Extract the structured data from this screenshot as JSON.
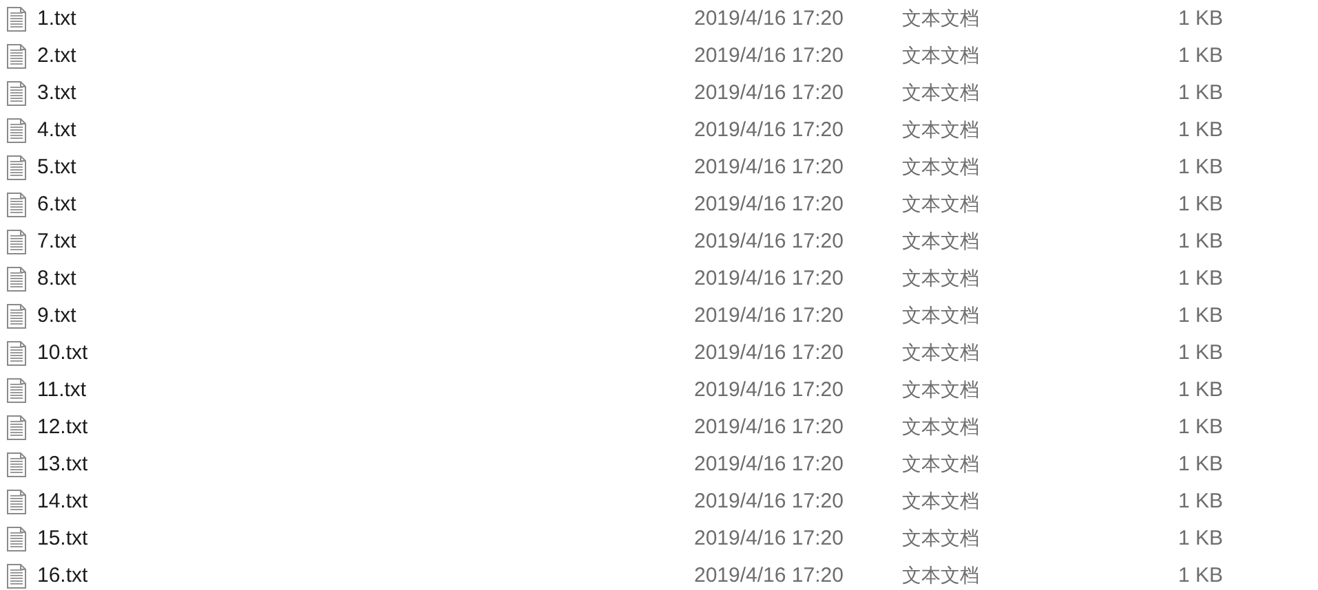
{
  "files": [
    {
      "name": "1.txt",
      "modified": "2019/4/16 17:20",
      "type": "文本文档",
      "size": "1 KB"
    },
    {
      "name": "2.txt",
      "modified": "2019/4/16 17:20",
      "type": "文本文档",
      "size": "1 KB"
    },
    {
      "name": "3.txt",
      "modified": "2019/4/16 17:20",
      "type": "文本文档",
      "size": "1 KB"
    },
    {
      "name": "4.txt",
      "modified": "2019/4/16 17:20",
      "type": "文本文档",
      "size": "1 KB"
    },
    {
      "name": "5.txt",
      "modified": "2019/4/16 17:20",
      "type": "文本文档",
      "size": "1 KB"
    },
    {
      "name": "6.txt",
      "modified": "2019/4/16 17:20",
      "type": "文本文档",
      "size": "1 KB"
    },
    {
      "name": "7.txt",
      "modified": "2019/4/16 17:20",
      "type": "文本文档",
      "size": "1 KB"
    },
    {
      "name": "8.txt",
      "modified": "2019/4/16 17:20",
      "type": "文本文档",
      "size": "1 KB"
    },
    {
      "name": "9.txt",
      "modified": "2019/4/16 17:20",
      "type": "文本文档",
      "size": "1 KB"
    },
    {
      "name": "10.txt",
      "modified": "2019/4/16 17:20",
      "type": "文本文档",
      "size": "1 KB"
    },
    {
      "name": "11.txt",
      "modified": "2019/4/16 17:20",
      "type": "文本文档",
      "size": "1 KB"
    },
    {
      "name": "12.txt",
      "modified": "2019/4/16 17:20",
      "type": "文本文档",
      "size": "1 KB"
    },
    {
      "name": "13.txt",
      "modified": "2019/4/16 17:20",
      "type": "文本文档",
      "size": "1 KB"
    },
    {
      "name": "14.txt",
      "modified": "2019/4/16 17:20",
      "type": "文本文档",
      "size": "1 KB"
    },
    {
      "name": "15.txt",
      "modified": "2019/4/16 17:20",
      "type": "文本文档",
      "size": "1 KB"
    },
    {
      "name": "16.txt",
      "modified": "2019/4/16 17:20",
      "type": "文本文档",
      "size": "1 KB"
    }
  ]
}
